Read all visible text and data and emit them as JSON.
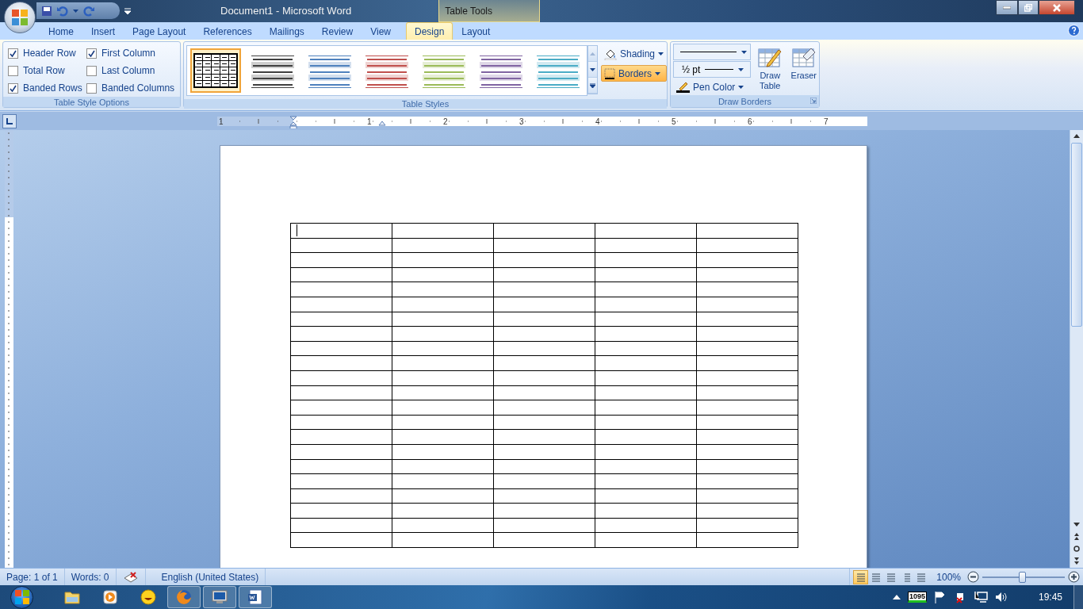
{
  "window": {
    "title": "Document1 - Microsoft Word",
    "contextual_group": "Table Tools"
  },
  "ribbon_tabs": [
    {
      "label": "Home",
      "selected": false
    },
    {
      "label": "Insert",
      "selected": false
    },
    {
      "label": "Page Layout",
      "selected": false
    },
    {
      "label": "References",
      "selected": false
    },
    {
      "label": "Mailings",
      "selected": false
    },
    {
      "label": "Review",
      "selected": false
    },
    {
      "label": "View",
      "selected": false
    },
    {
      "label": "Design",
      "selected": true
    },
    {
      "label": "Layout",
      "selected": false
    }
  ],
  "table_style_options": {
    "title": "Table Style Options",
    "options": [
      {
        "label": "Header Row",
        "checked": true
      },
      {
        "label": "Total Row",
        "checked": false
      },
      {
        "label": "Banded Rows",
        "checked": true
      },
      {
        "label": "First Column",
        "checked": true
      },
      {
        "label": "Last Column",
        "checked": false
      },
      {
        "label": "Banded Columns",
        "checked": false
      }
    ]
  },
  "table_styles": {
    "title": "Table Styles",
    "styles": [
      {
        "color": "#000000",
        "selected": true
      },
      {
        "color": "#404040",
        "selected": false
      },
      {
        "color": "#4f81bd",
        "selected": false
      },
      {
        "color": "#c0504d",
        "selected": false
      },
      {
        "color": "#9bbb59",
        "selected": false
      },
      {
        "color": "#8064a2",
        "selected": false
      },
      {
        "color": "#4bacc6",
        "selected": false
      }
    ],
    "shading": "Shading",
    "borders": {
      "label": "Borders",
      "selected": true
    }
  },
  "draw_borders": {
    "title": "Draw Borders",
    "line_weight": "½ pt",
    "pen_color": "Pen Color",
    "draw_table": "Draw Table",
    "eraser": "Eraser"
  },
  "ruler": {
    "numbers": [
      "1",
      "1",
      "2",
      "3",
      "4",
      "5",
      "6",
      "7"
    ]
  },
  "status_bar": {
    "page": "Page: 1 of 1",
    "words": "Words: 0",
    "language": "English (United States)",
    "views": [
      {
        "selected": true
      },
      {
        "selected": false
      },
      {
        "selected": false
      },
      {
        "selected": false
      },
      {
        "selected": false
      }
    ],
    "zoom": "100%",
    "zoom_slider": {
      "level": 0.48
    }
  },
  "taskbar": {
    "apps": [
      {
        "kind": "folder",
        "open": false
      },
      {
        "kind": "media",
        "open": false
      },
      {
        "kind": "smiley",
        "open": false
      },
      {
        "kind": "browser",
        "open": true
      },
      {
        "kind": "monitor",
        "open": true
      },
      {
        "kind": "word",
        "open": true
      }
    ],
    "tray_counter": "1095",
    "clock": "19:45"
  }
}
